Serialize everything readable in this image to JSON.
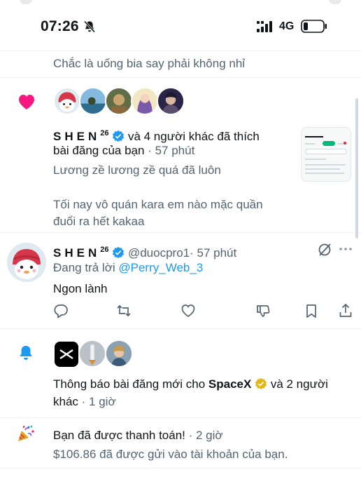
{
  "status_bar": {
    "time": "07:26",
    "network": "4G"
  },
  "notifications": [
    {
      "type": "text-snippet",
      "text": "Chắc là uống bia say phải không nhỉ"
    },
    {
      "type": "like",
      "icon": "heart-icon",
      "user_name": "SHEN",
      "user_superscript": "26",
      "action_text": "và 4 người khác đã thích",
      "action_text_2": "bài đăng của bạn",
      "time": "· 57 phút",
      "post_line_1": "Lương zề lương zề quá đã luôn",
      "post_line_2": "Tối nay vô quán kara em nào mặc quần",
      "post_line_3": "đuổi ra hết kakaa"
    },
    {
      "type": "reply",
      "user_name": "SHEN",
      "user_superscript": "26",
      "handle": "@duocpro1",
      "time": "· 57 phút",
      "replying_label": "Đang trả lời",
      "replying_to": "@Perry_Web_3",
      "text": "Ngon lành"
    },
    {
      "type": "new-post",
      "icon": "bell-icon",
      "line_1_prefix": "Thông báo bài đăng mới cho",
      "account": "SpaceX",
      "line_1_suffix": "và 2 người",
      "line_2": "khác",
      "time": "· 1 giờ"
    },
    {
      "type": "payment",
      "icon": "party-popper-icon",
      "title": "Bạn đã được thanh toán!",
      "time": "· 2 giờ",
      "body": "$106.86 đã được gửi vào tài khoản của bạn."
    }
  ],
  "colors": {
    "accent": "#1d9bf0",
    "like": "#f91880",
    "muted": "#536471",
    "gold": "#e2b719"
  }
}
